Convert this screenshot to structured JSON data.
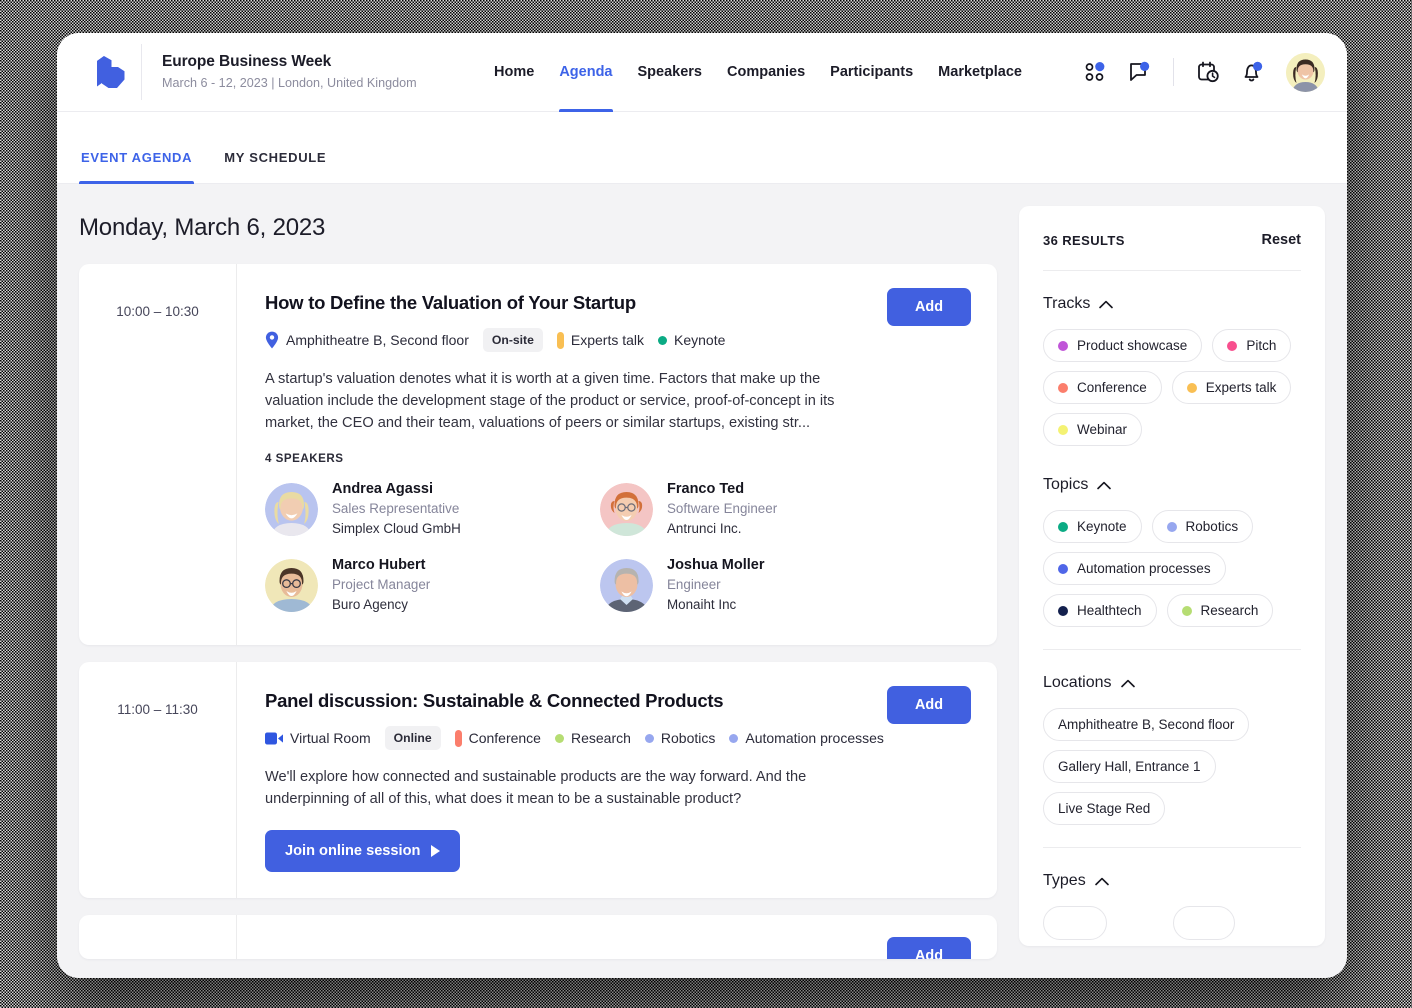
{
  "header": {
    "logo_icon": "company-logo-icon",
    "brand_title": "Europe Business Week",
    "brand_subtitle": "March 6 - 12, 2023 | London, United Kingdom",
    "nav": [
      {
        "label": "Home",
        "active": false
      },
      {
        "label": "Agenda",
        "active": true
      },
      {
        "label": "Speakers",
        "active": false
      },
      {
        "label": "Companies",
        "active": false
      },
      {
        "label": "Participants",
        "active": false
      },
      {
        "label": "Marketplace",
        "active": false
      }
    ],
    "icons": [
      {
        "name": "apps-grid-icon",
        "badge": true
      },
      {
        "name": "chat-bubble-icon",
        "badge": true
      },
      {
        "name": "calendar-clock-icon",
        "badge": false
      },
      {
        "name": "bell-notification-icon",
        "badge": true
      }
    ],
    "avatar_name": "user-avatar"
  },
  "subtabs": [
    {
      "label": "EVENT AGENDA",
      "active": true
    },
    {
      "label": "MY SCHEDULE",
      "active": false
    }
  ],
  "agenda": {
    "day_title": "Monday, March 6, 2023",
    "sessions": [
      {
        "time": "10:00 – 10:30",
        "title": "How to Define the Valuation of Your Startup",
        "location": "Amphitheatre B, Second floor",
        "location_icon": "map-pin-icon",
        "mode": "On-site",
        "tags": [
          {
            "label": "Experts talk",
            "color": "#f9bf53",
            "shape": "bar"
          },
          {
            "label": "Keynote",
            "color": "#0bab84",
            "shape": "dot"
          }
        ],
        "description": "A startup's valuation denotes what it is worth at a given time. Factors that make up the valuation include the development stage of the product or service, proof-of-concept in its market, the CEO and their team, valuations of peers or similar startups, existing str...",
        "speakers_label": "4 SPEAKERS",
        "speakers": [
          {
            "name": "Andrea Agassi",
            "role": "Sales Representative",
            "org": "Simplex Cloud GmbH",
            "bg": "#b9c4ef",
            "skin": "#f0cdb4",
            "hair": "#e7d7a8"
          },
          {
            "name": "Franco Ted",
            "role": "Software Engineer",
            "org": "Antrunci Inc.",
            "bg": "#f4c5c4",
            "skin": "#f3cbb0",
            "hair": "#d4703a"
          },
          {
            "name": "Marco Hubert",
            "role": "Project Manager",
            "org": "Buro Agency",
            "bg": "#f0e7b8",
            "skin": "#e8bb98",
            "hair": "#5b4232"
          },
          {
            "name": "Joshua Moller",
            "role": "Engineer",
            "org": "Monaiht Inc",
            "bg": "#bcc6ef",
            "skin": "#edbfa4",
            "hair": "#b9b6b2"
          }
        ],
        "add_label": "Add"
      },
      {
        "time": "11:00 – 11:30",
        "title": "Panel discussion: Sustainable & Connected Products",
        "location": "Virtual Room",
        "location_icon": "video-camera-icon",
        "mode": "Online",
        "tags": [
          {
            "label": "Conference",
            "color": "#fb7e6c",
            "shape": "bar"
          },
          {
            "label": "Research",
            "color": "#b6dd73",
            "shape": "dot"
          },
          {
            "label": "Robotics",
            "color": "#97a7ef",
            "shape": "dot"
          },
          {
            "label": "Automation processes",
            "color": "#97a7ef",
            "shape": "dot"
          }
        ],
        "description": "We'll explore how connected and sustainable products are the way forward. And the underpinning of all of this, what does it mean to be a sustainable product?",
        "join_label": "Join online session",
        "add_label": "Add"
      },
      {
        "time": "",
        "title": "",
        "add_label": "Add"
      }
    ]
  },
  "filters": {
    "results_label": "36 RESULTS",
    "reset_label": "Reset",
    "sections": [
      {
        "title": "Tracks",
        "chips": [
          {
            "label": "Product showcase",
            "color": "#c055d8"
          },
          {
            "label": "Pitch",
            "color": "#f84f8e"
          },
          {
            "label": "Conference",
            "color": "#fb7e6c"
          },
          {
            "label": "Experts talk",
            "color": "#f9bf53"
          },
          {
            "label": "Webinar",
            "color": "#f4f273"
          }
        ]
      },
      {
        "title": "Topics",
        "chips": [
          {
            "label": "Keynote",
            "color": "#0bab84"
          },
          {
            "label": "Robotics",
            "color": "#97a7ef"
          },
          {
            "label": "Automation processes",
            "color": "#4f66e8"
          },
          {
            "label": "Healthtech",
            "color": "#13204d"
          },
          {
            "label": "Research",
            "color": "#b6dd73"
          }
        ]
      },
      {
        "title": "Locations",
        "chips": [
          {
            "label": "Amphitheatre B, Second floor",
            "color": ""
          },
          {
            "label": "Gallery Hall, Entrance 1",
            "color": ""
          },
          {
            "label": "Live Stage Red",
            "color": ""
          }
        ]
      },
      {
        "title": "Types",
        "chips": []
      }
    ]
  },
  "colors": {
    "accent": "#4160e0",
    "link": "#3d63e8",
    "page_bg": "#f3f3f5"
  }
}
